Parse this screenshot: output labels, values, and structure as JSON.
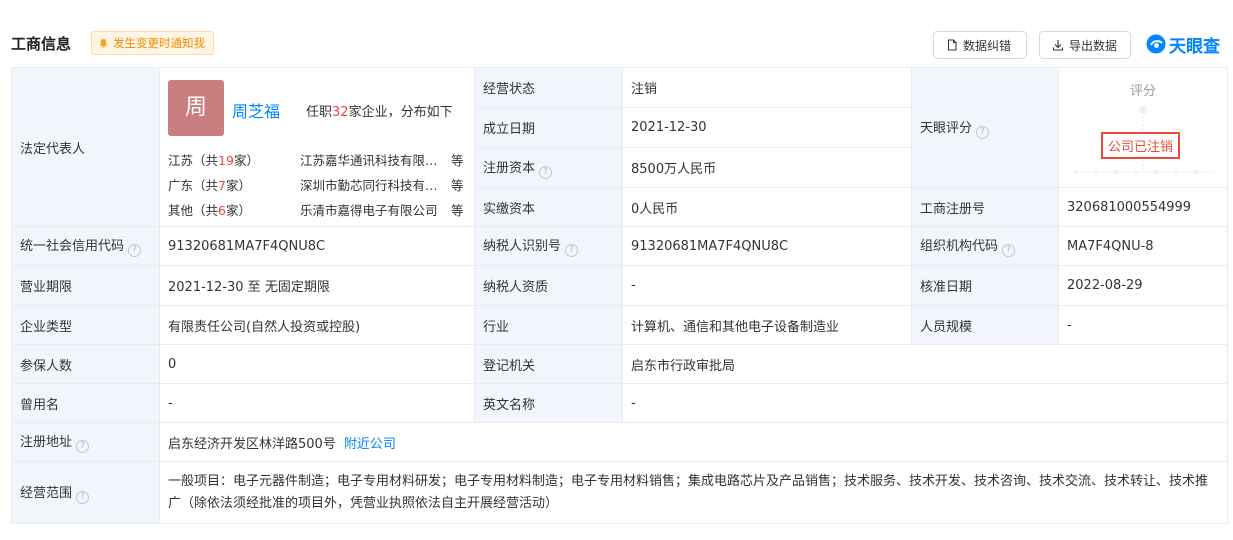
{
  "header": {
    "title": "工商信息",
    "notify": "发生变更时通知我",
    "btn_correct": "数据纠错",
    "btn_export": "导出数据",
    "logo_text": "天眼查"
  },
  "legal_rep": {
    "label": "法定代表人",
    "avatar_char": "周",
    "name": "周芝福",
    "tenure_prefix": "任职",
    "tenure_count": "32",
    "tenure_suffix": "家企业，分布如下",
    "companies": [
      {
        "region": "江苏",
        "count": "19",
        "name": "江苏嘉华通讯科技有限公司",
        "etc": "等"
      },
      {
        "region": "广东",
        "count": "7",
        "name": "深圳市勤芯同行科技有限公司",
        "etc": "等"
      },
      {
        "region": "其他",
        "count": "6",
        "name": "乐清市嘉得电子有限公司",
        "etc": "等"
      }
    ]
  },
  "fields": {
    "status_label": "经营状态",
    "status_value": "注销",
    "established_label": "成立日期",
    "established_value": "2021-12-30",
    "reg_capital_label": "注册资本",
    "reg_capital_value": "8500万人民币",
    "paid_capital_label": "实缴资本",
    "paid_capital_value": "0人民币",
    "score_label": "天眼评分",
    "score_header": "评分",
    "score_stamp": "公司已注销",
    "biz_reg_no_label": "工商注册号",
    "biz_reg_no_value": "320681000554999",
    "credit_code_label": "统一社会信用代码",
    "credit_code_value": "91320681MA7F4QNU8C",
    "taxpayer_id_label": "纳税人识别号",
    "taxpayer_id_value": "91320681MA7F4QNU8C",
    "org_code_label": "组织机构代码",
    "org_code_value": "MA7F4QNU-8",
    "term_label": "营业期限",
    "term_value": "2021-12-30 至 无固定期限",
    "taxpayer_qual_label": "纳税人资质",
    "taxpayer_qual_value": "-",
    "approval_label": "核准日期",
    "approval_value": "2022-08-29",
    "type_label": "企业类型",
    "type_value": "有限责任公司(自然人投资或控股)",
    "industry_label": "行业",
    "industry_value": "计算机、通信和其他电子设备制造业",
    "staff_label": "人员规模",
    "staff_value": "-",
    "insured_label": "参保人数",
    "insured_value": "0",
    "authority_label": "登记机关",
    "authority_value": "启东市行政审批局",
    "former_name_label": "曾用名",
    "former_name_value": "-",
    "en_name_label": "英文名称",
    "en_name_value": "-",
    "address_label": "注册地址",
    "address_value": "启东经济开发区林洋路500号",
    "address_link": "附近公司",
    "scope_label": "经营范围",
    "scope_value": "一般项目：电子元器件制造；电子专用材料研发；电子专用材料制造；电子专用材料销售；集成电路芯片及产品销售；技术服务、技术开发、技术咨询、技术交流、技术转让、技术推广（除依法须经批准的项目外，凭营业执照依法自主开展经营活动）"
  },
  "colors": {
    "accent": "#0084ff",
    "label_bg": "#f2f6fc",
    "warn": "#f08a00",
    "red": "#e74c3c"
  }
}
